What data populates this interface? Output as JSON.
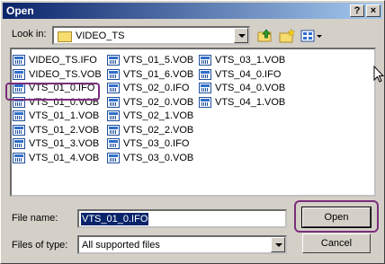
{
  "window": {
    "title": "Open",
    "help_button": "?",
    "close_button": "×"
  },
  "lookin": {
    "label": "Look in:",
    "value": "VIDEO_TS"
  },
  "toolbar": {
    "icons": [
      "up-folder-icon",
      "new-folder-icon",
      "view-menu-icon"
    ]
  },
  "files": {
    "col1": [
      "VIDEO_TS.IFO",
      "VIDEO_TS.VOB",
      "VTS_01_0.IFO",
      "VTS_01_0.VOB",
      "VTS_01_1.VOB",
      "VTS_01_2.VOB",
      "VTS_01_3.VOB",
      "VTS_01_4.VOB"
    ],
    "col2": [
      "VTS_01_5.VOB",
      "VTS_01_6.VOB",
      "VTS_02_0.IFO",
      "VTS_02_0.VOB",
      "VTS_02_1.VOB",
      "VTS_02_2.VOB",
      "VTS_03_0.IFO",
      "VTS_03_0.VOB"
    ],
    "col3": [
      "VTS_03_1.VOB",
      "VTS_04_0.IFO",
      "VTS_04_0.VOB",
      "VTS_04_1.VOB"
    ]
  },
  "filename": {
    "label": "File name:",
    "value": "VTS_01_0.IFO"
  },
  "filetype": {
    "label": "Files of type:",
    "value": "All supported files"
  },
  "buttons": {
    "open": "Open",
    "cancel": "Cancel"
  },
  "colors": {
    "title_bar": "#0a246a",
    "highlight": "#7b2d7b",
    "face": "#d4d0c8"
  }
}
